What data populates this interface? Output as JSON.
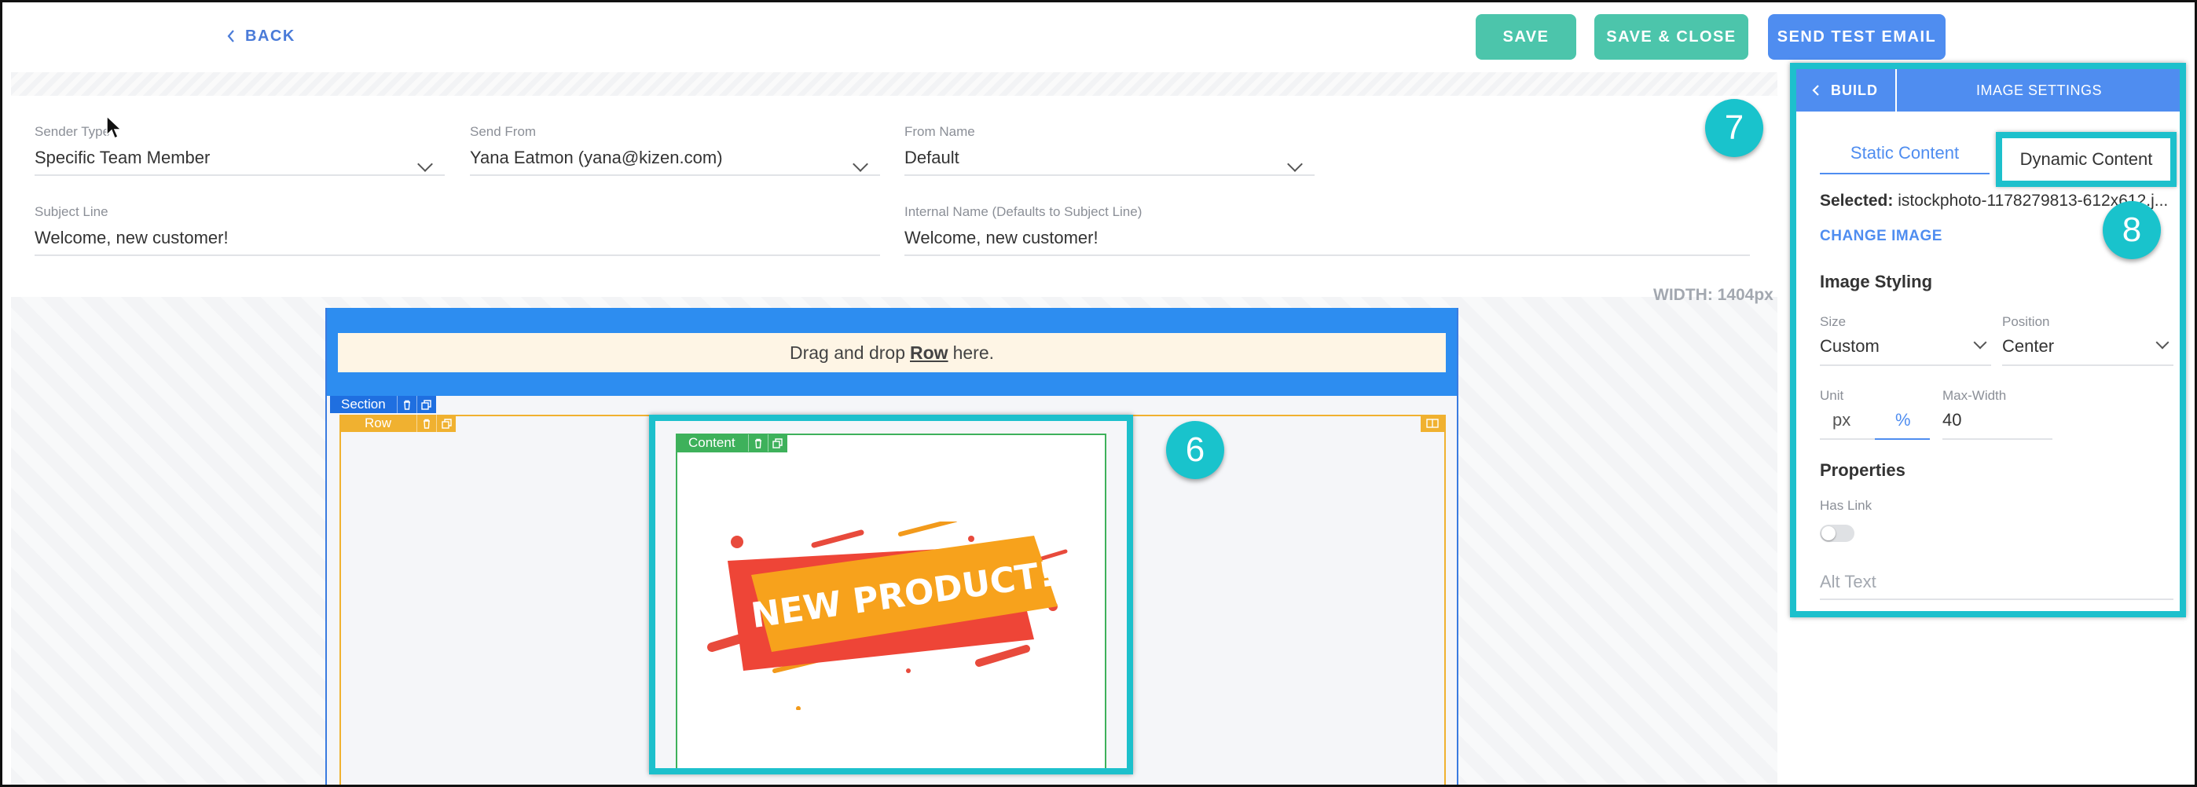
{
  "topbar": {
    "back_label": "BACK",
    "save_label": "SAVE",
    "save_close_label": "SAVE & CLOSE",
    "send_test_label": "SEND TEST EMAIL"
  },
  "form": {
    "sender_type": {
      "label": "Sender Type",
      "value": "Specific Team Member"
    },
    "send_from": {
      "label": "Send From",
      "value": "Yana Eatmon (yana@kizen.com)"
    },
    "from_name": {
      "label": "From Name",
      "value": "Default"
    },
    "subject_line": {
      "label": "Subject Line",
      "value": "Welcome, new customer!"
    },
    "internal_name": {
      "label": "Internal Name (Defaults to Subject Line)",
      "value": "Welcome, new customer!"
    }
  },
  "canvas": {
    "width_label": "WIDTH: 1404px",
    "drop_row_prefix": "Drag and drop",
    "drop_row_bold": "Row",
    "drop_row_suffix": "here.",
    "section_tag": "Section",
    "row_tag": "Row",
    "content_tag": "Content",
    "image_text": "NEW PRODUCT!"
  },
  "panel": {
    "build_label": "BUILD",
    "title": "IMAGE SETTINGS",
    "tab_static": "Static Content",
    "tab_dynamic": "Dynamic Content",
    "selected_label": "Selected:",
    "selected_value": "istockphoto-1178279813-612x612.j...",
    "change_image": "CHANGE IMAGE",
    "image_styling": "Image Styling",
    "size_label": "Size",
    "size_value": "Custom",
    "position_label": "Position",
    "position_value": "Center",
    "unit_label": "Unit",
    "unit_px": "px",
    "unit_pct": "%",
    "max_width_label": "Max-Width",
    "max_width_value": "40",
    "properties": "Properties",
    "has_link_label": "Has Link",
    "has_link_on": false,
    "alt_text_placeholder": "Alt Text"
  },
  "annotations": {
    "badge_6": "6",
    "badge_7": "7",
    "badge_8": "8"
  },
  "colors": {
    "accent_blue": "#4f8df0",
    "teal_button": "#4cc5ab",
    "highlight": "#1dc0cc",
    "row_orange": "#f0b130",
    "content_green": "#3eb15b"
  },
  "icons": [
    "chevron-left-icon",
    "chevron-down-icon",
    "trash-icon",
    "copy-icon",
    "mouse-cursor-icon"
  ]
}
